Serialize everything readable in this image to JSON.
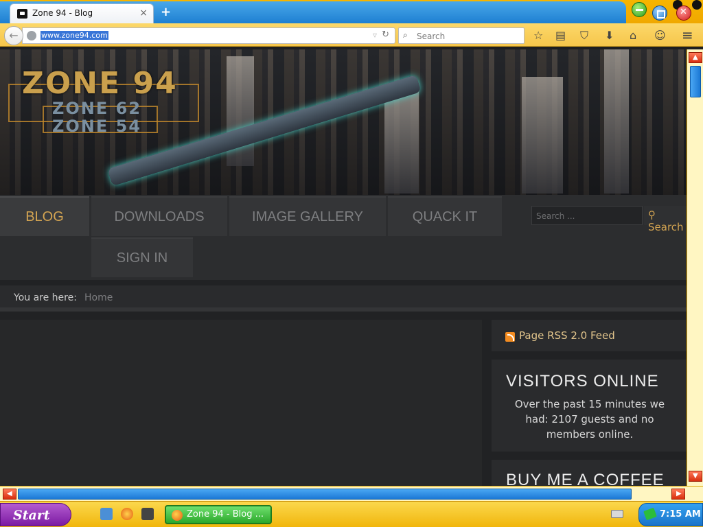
{
  "browser": {
    "tab_title": "Zone 94 - Blog",
    "tab_close": "×",
    "new_tab": "+",
    "url": "www.zone94.com",
    "search_placeholder": "Search",
    "back_icon": "←",
    "reload_icon": "↻",
    "dropdown_icon": "▿"
  },
  "toolbar": {
    "icons": [
      "star-icon",
      "reading-list-icon",
      "pocket-icon",
      "download-icon",
      "home-icon",
      "chat-icon",
      "menu-icon"
    ],
    "glyphs": [
      "☆",
      "▤",
      "⛉",
      "⬇",
      "⌂",
      "☺",
      "≡"
    ]
  },
  "site": {
    "logo": {
      "main": "ZONE 94",
      "sub1": "ZONE 62",
      "sub2": "ZONE 54"
    },
    "menu": {
      "blog": "BLOG",
      "downloads": "DOWNLOADS",
      "image_gallery": "IMAGE GALLERY",
      "quack_it": "QUACK IT",
      "sign_in": "SIGN IN"
    },
    "search": {
      "placeholder": "Search ...",
      "button": "Search"
    },
    "breadcrumb": {
      "label": "You are here:",
      "home": "Home"
    },
    "sidebar": {
      "rss_label": "Page RSS 2.0 Feed",
      "visitors_title": "VISITORS ONLINE",
      "visitors_text": "Over the past 15 minutes we had: 2107 guests and no members online.",
      "coffee_title": "BUY ME A COFFEE"
    }
  },
  "taskbar": {
    "start": "Start",
    "task_label": "Zone 94 - Blog ...",
    "clock": "7:15 AM"
  },
  "colors": {
    "accent_gold": "#d3a452",
    "chrome_yellow": "#f6c64b",
    "tab_blue": "#1e7fd1"
  }
}
